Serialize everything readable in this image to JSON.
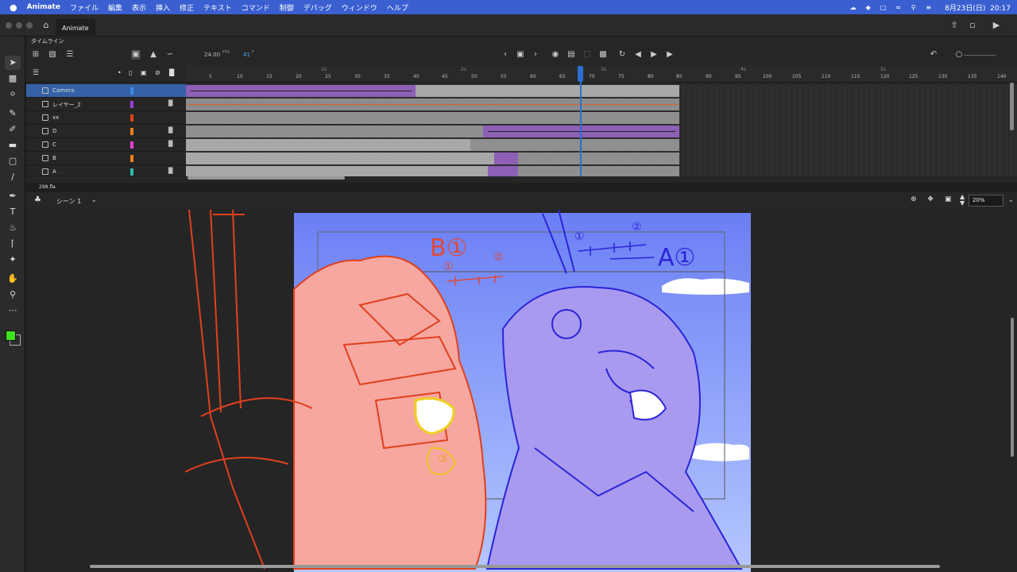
{
  "menubar": {
    "apple": "",
    "app_name": "Animate",
    "items": [
      "ファイル",
      "編集",
      "表示",
      "挿入",
      "修正",
      "テキスト",
      "コマンド",
      "制御",
      "デバッグ",
      "ウィンドウ",
      "ヘルプ"
    ],
    "clock": "8月23日(日)  20:17"
  },
  "tabbar": {
    "tab_label": "Animate"
  },
  "timeline": {
    "title": "タイムライン",
    "fps": "24.00",
    "fps_unit": "FPS",
    "current_frame": "41",
    "frame_unit": "F",
    "ruler_numbers": [
      "5",
      "10",
      "15",
      "20",
      "25",
      "30",
      "35",
      "40",
      "45",
      "50",
      "55",
      "60",
      "65",
      "70",
      "75",
      "80",
      "85",
      "90",
      "95",
      "100",
      "105",
      "110",
      "115",
      "120",
      "125",
      "130",
      "135",
      "140"
    ],
    "second_marks": [
      "1s",
      "2s",
      "3s",
      "4s",
      "5s"
    ],
    "layers": [
      {
        "name": "Camera",
        "color": "#3b8de0",
        "locked": false,
        "selected": true
      },
      {
        "name": "レイヤー_2",
        "color": "#9b3fd6",
        "locked": true,
        "selected": false
      },
      {
        "name": "xx",
        "color": "#e0401d",
        "locked": false,
        "selected": false
      },
      {
        "name": "D",
        "color": "#f0801a",
        "locked": true,
        "selected": false
      },
      {
        "name": "C",
        "color": "#e63fd2",
        "locked": true,
        "selected": false
      },
      {
        "name": "B",
        "color": "#f07f1a",
        "locked": false,
        "selected": false
      },
      {
        "name": "A",
        "color": "#2fb8b0",
        "locked": true,
        "selected": false
      }
    ]
  },
  "document": {
    "filename": "298.fla"
  },
  "scene": {
    "label": "シーン 1"
  },
  "stage": {
    "zoom": "20%",
    "annotations": {
      "b1": "B①",
      "a1": "A①",
      "n1": "①",
      "n2": "②",
      "n3": "③"
    }
  },
  "colors": {
    "accent": "#3a5fd0",
    "selected_row": "#3561a6",
    "playhead": "#2b6fd1",
    "tween_purple": "#8d5fb5",
    "fill_green": "#3fe020"
  },
  "icons": [
    "apple-icon",
    "home-icon",
    "share-icon",
    "panel-icon",
    "play-icon",
    "selection-icon",
    "free-transform-icon",
    "lasso-icon",
    "brush-icon",
    "paint-brush-icon",
    "eraser-icon",
    "rectangle-icon",
    "line-icon",
    "pen-icon",
    "text-icon",
    "paint-bucket-icon",
    "eyedropper-icon",
    "pin-icon",
    "hand-icon",
    "zoom-icon",
    "more-icon"
  ]
}
